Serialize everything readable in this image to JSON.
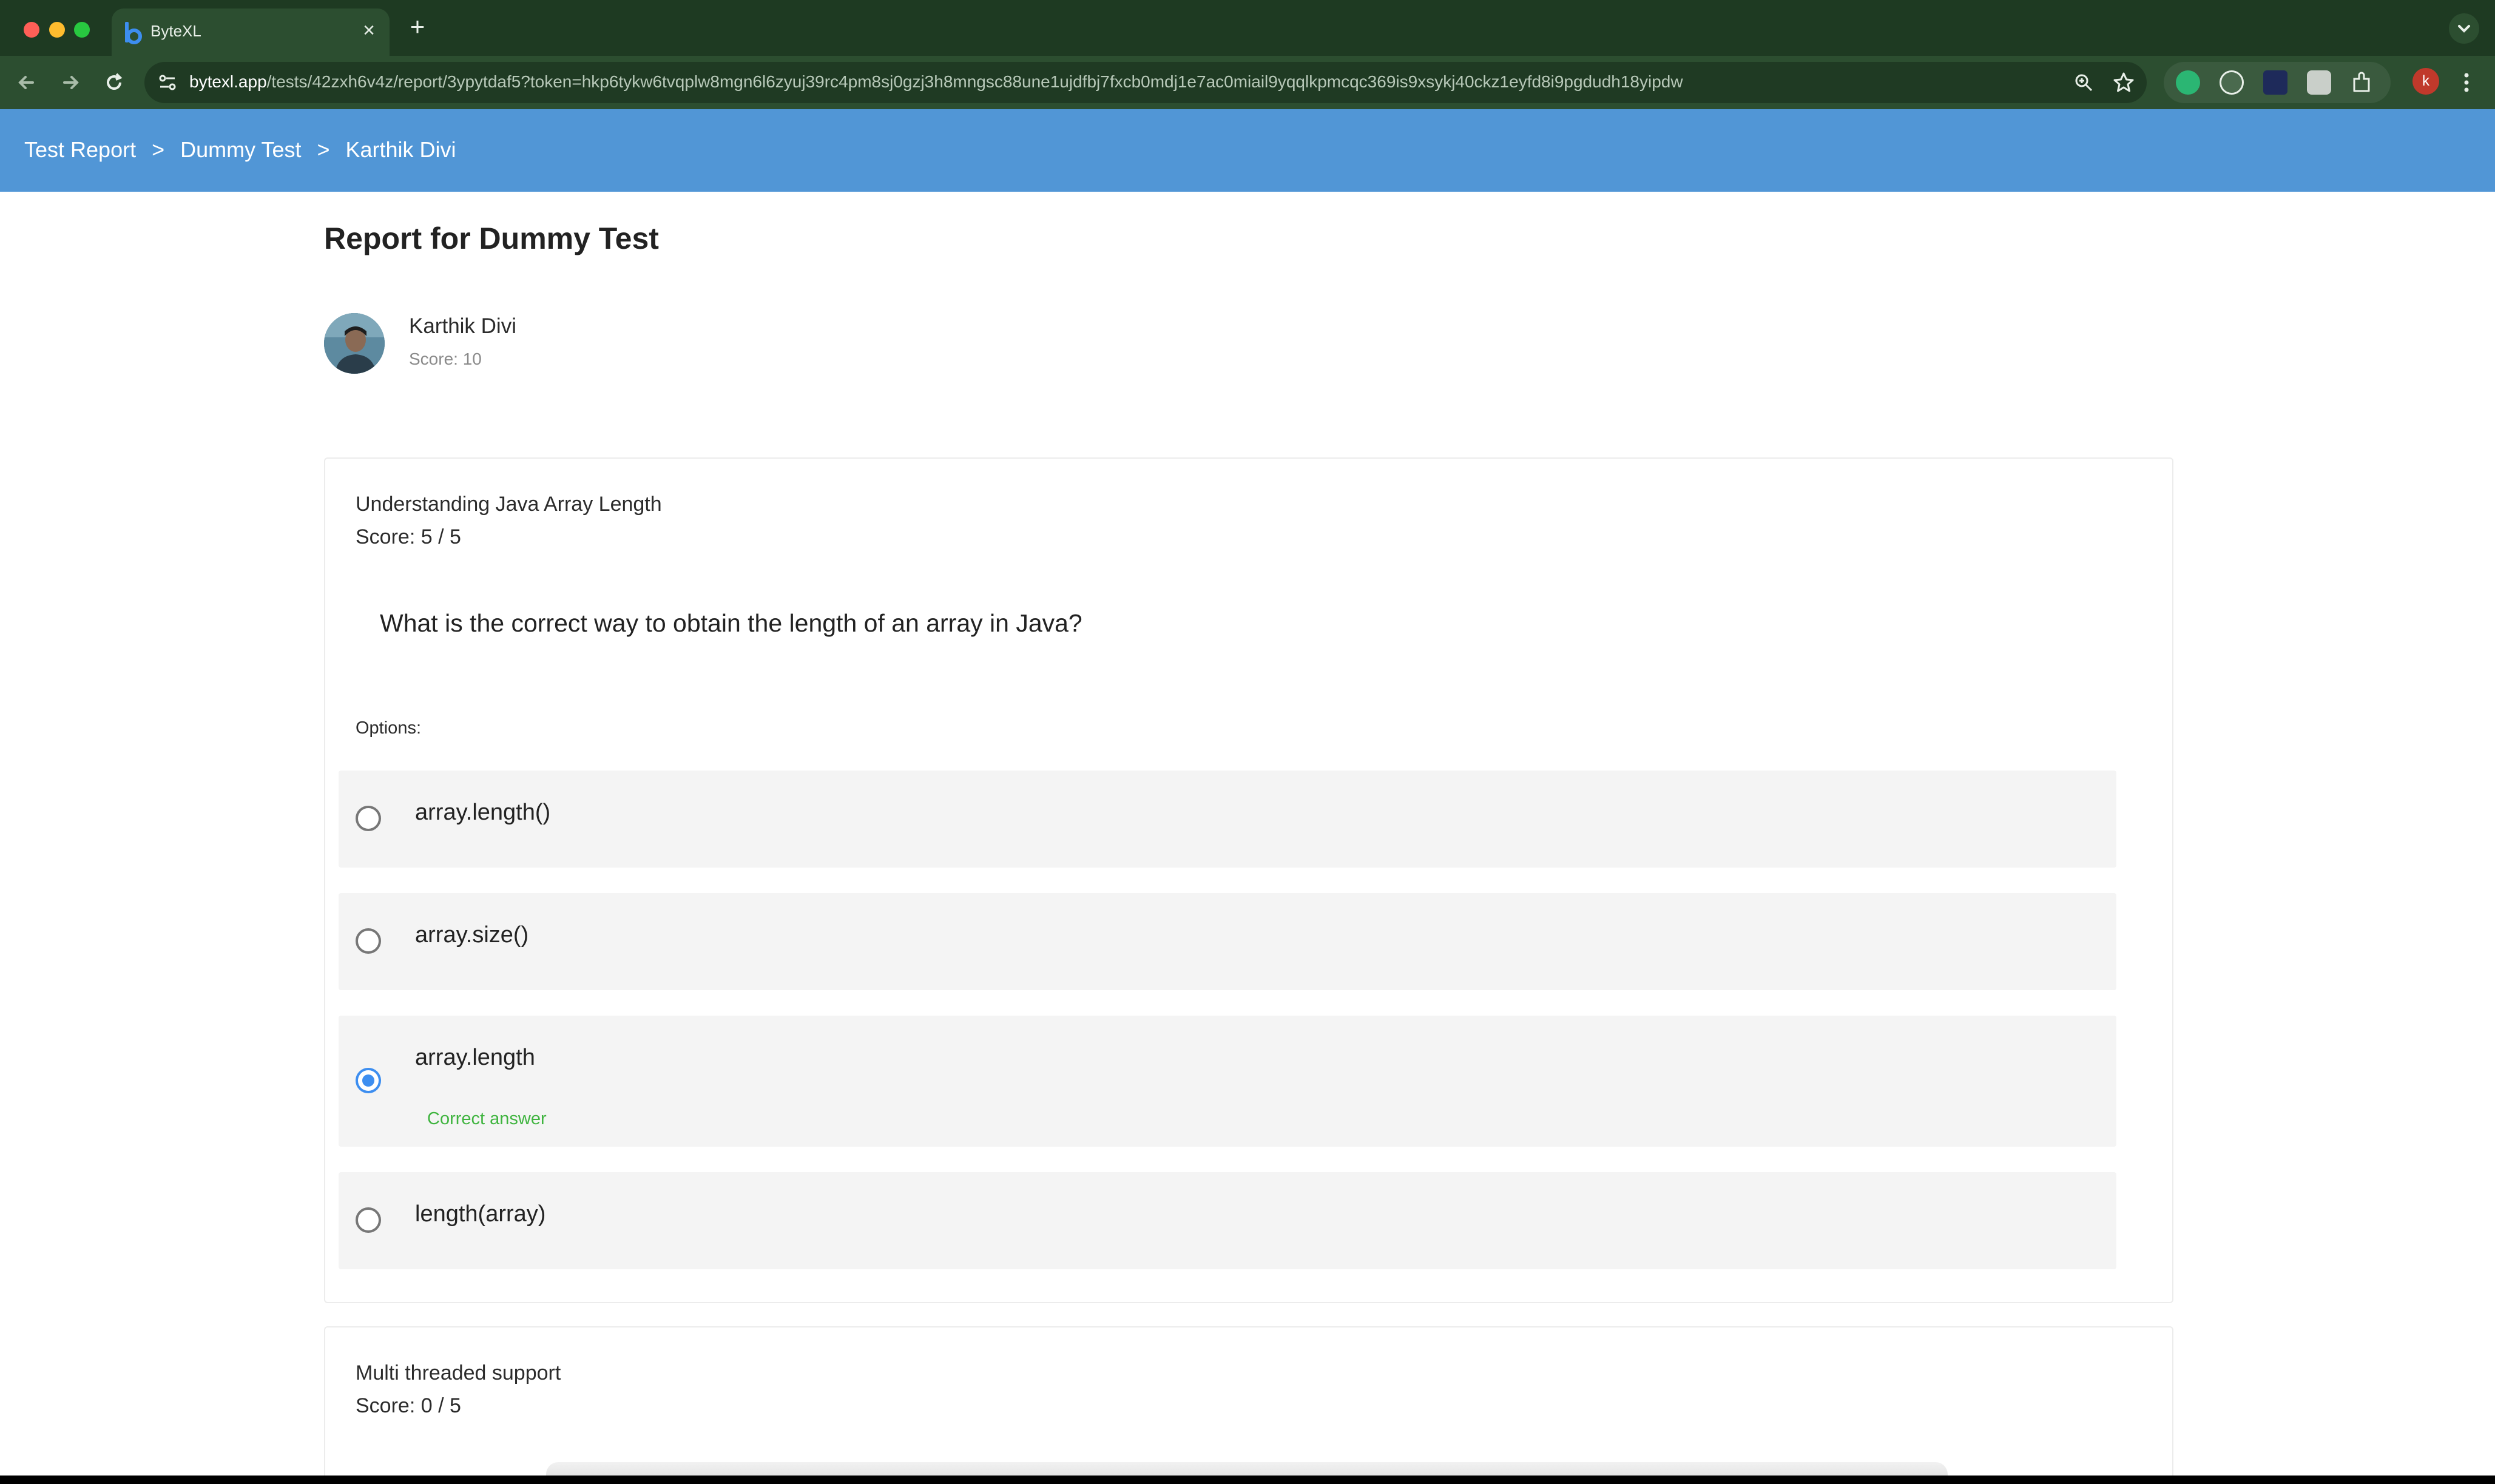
{
  "browser": {
    "tab_title": "ByteXL",
    "new_tab_glyph": "+",
    "close_glyph": "×",
    "url_host": "bytexl.app",
    "url_path": "/tests/42zxh6v4z/report/3ypytdaf5?token=hkp6tykw6tvqplw8mgn6l6zyuj39rc4pm8sj0gzj3h8mngsc88une1ujdfbj7fxcb0mdj1e7ac0miail9yqqlkpmcqc369is9xsykj40ckz1eyfd8i9pgdudh18yipdw",
    "profile_initial": "k",
    "icons": [
      "back-arrow-icon",
      "forward-arrow-icon",
      "reload-icon",
      "site-settings-icon",
      "zoom-icon",
      "bookmark-star-icon",
      "extensions-icon",
      "more-menu-icon"
    ]
  },
  "breadcrumb": {
    "items": [
      "Test Report",
      "Dummy Test",
      "Karthik Divi"
    ],
    "separator": ">"
  },
  "report": {
    "title": "Report for Dummy Test",
    "student_name": "Karthik Divi",
    "student_score": "Score: 10"
  },
  "questions": [
    {
      "title": "Understanding Java Array Length",
      "score": "Score: 5 / 5",
      "text": "What is the correct way to obtain the length of an array in Java?",
      "options_label": "Options:",
      "options": [
        {
          "label": "array.length()",
          "selected": false
        },
        {
          "label": "array.size()",
          "selected": false
        },
        {
          "label": "array.length",
          "selected": true,
          "note": "Correct answer"
        },
        {
          "label": "length(array)",
          "selected": false
        }
      ]
    },
    {
      "title": "Multi threaded support",
      "score": "Score: 0 / 5"
    }
  ],
  "colors": {
    "header_bg": "#5196d6",
    "browser_frame": "#1e3a22",
    "radio_selected": "#3d8ef0",
    "correct_text": "#3fb43f"
  }
}
